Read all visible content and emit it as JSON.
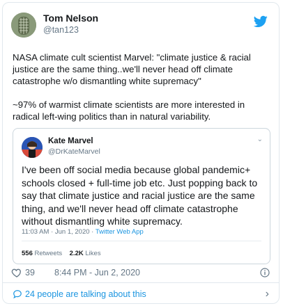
{
  "author": {
    "name": "Tom Nelson",
    "handle": "@tan123"
  },
  "tweet": {
    "paragraphs": [
      "NASA climate cult scientist Marvel: \"climate justice & racial justice are the same thing..we'll never head off climate catastrophe w/o dismantling white supremacy\"",
      "~97% of warmist climate scientists are more interested in radical left-wing politics than in natural variability."
    ]
  },
  "quoted": {
    "name": "Kate Marvel",
    "handle": "@DrKateMarvel",
    "text": "I've been off social media because global pandemic+ schools closed + full-time job etc. Just popping back to say that climate justice and racial justice are the same thing, and we'll never head off climate catastrophe without dismantling white supremacy.",
    "timestamp": "11:03 AM · Jun 1, 2020 · ",
    "source": "Twitter Web App",
    "retweets": "556",
    "retweets_label": " Retweets",
    "likes": "2.2K",
    "likes_label": " Likes"
  },
  "actions": {
    "likes": "39",
    "timestamp": "8:44 PM - Jun 2, 2020"
  },
  "footer": {
    "talking": "24 people are talking about this"
  },
  "colors": {
    "accent": "#1da1f2",
    "link": "#1b95e0",
    "muted": "#657786"
  },
  "icons": [
    "avatar",
    "twitter-bird-icon",
    "chevron-down-icon",
    "heart-icon",
    "info-icon",
    "speech-bubble-icon",
    "chevron-right-icon"
  ]
}
